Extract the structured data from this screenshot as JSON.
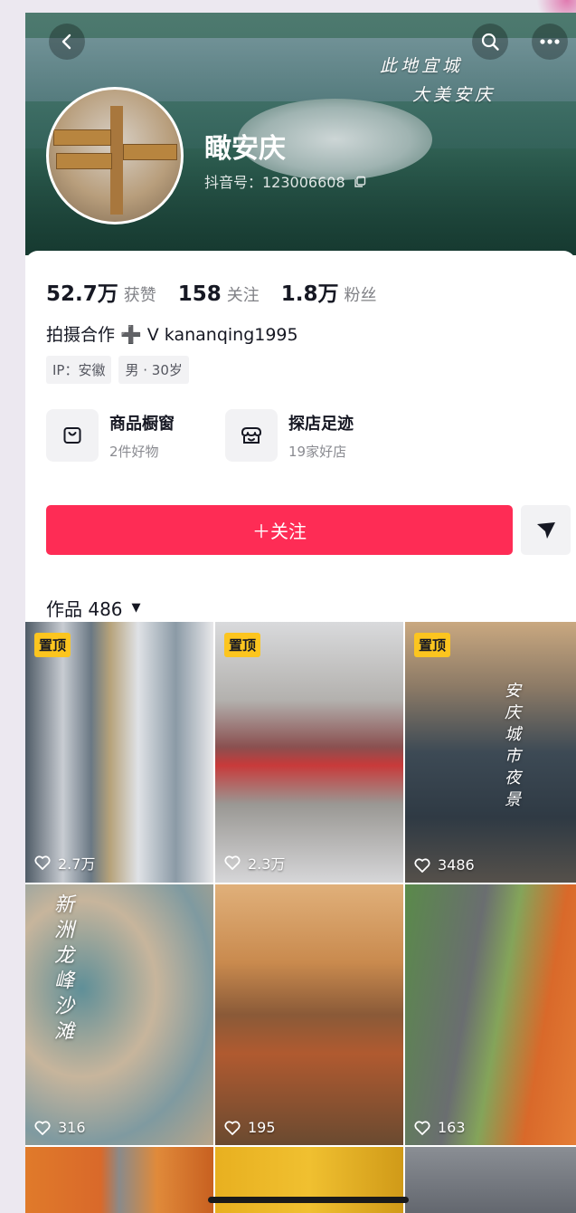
{
  "cover": {
    "line1": "此地宜城",
    "line2": "大美安庆"
  },
  "profile": {
    "name": "瞰安庆",
    "douyin_id": "抖音号：123006608"
  },
  "stats": [
    {
      "num": "52.7万",
      "label": "获赞"
    },
    {
      "num": "158",
      "label": "关注"
    },
    {
      "num": "1.8万",
      "label": "粉丝"
    }
  ],
  "bio": "拍摄合作 ➕ V kananqing1995",
  "tags": [
    "IP：安徽",
    "男 · 30岁"
  ],
  "shops": [
    {
      "title": "商品橱窗",
      "sub": "2件好物",
      "icon": "bag-icon"
    },
    {
      "title": "探店足迹",
      "sub": "19家好店",
      "icon": "store-icon"
    }
  ],
  "follow_label": "＋关注",
  "works_label": "作品 486",
  "pin_label": "置顶",
  "videos": [
    {
      "likes": "2.7万",
      "pinned": true
    },
    {
      "likes": "2.3万",
      "pinned": true
    },
    {
      "likes": "3486",
      "pinned": true,
      "overlay": "安庆城市夜景"
    },
    {
      "likes": "316",
      "pinned": false,
      "overlay": "新洲龙峰沙滩"
    },
    {
      "likes": "195",
      "pinned": false
    },
    {
      "likes": "163",
      "pinned": false
    }
  ],
  "colors": {
    "accent": "#fe2c55",
    "pin": "#fcc51f"
  }
}
